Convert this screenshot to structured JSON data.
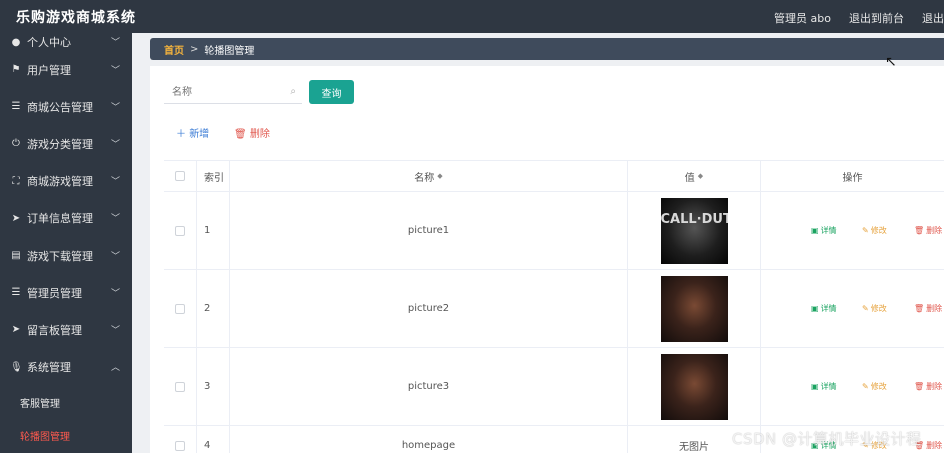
{
  "app": {
    "title": "乐购游戏商城系统"
  },
  "header": {
    "user": "管理员 abo",
    "back_frontend": "退出到前台",
    "logout": "退出"
  },
  "sidebar": {
    "items": [
      {
        "label": "个人中心",
        "icon": "person-icon"
      },
      {
        "label": "用户管理",
        "icon": "flag-icon"
      },
      {
        "label": "商城公告管理",
        "icon": "list-icon"
      },
      {
        "label": "游戏分类管理",
        "icon": "power-icon"
      },
      {
        "label": "商城游戏管理",
        "icon": "frame-icon"
      },
      {
        "label": "订单信息管理",
        "icon": "send-icon"
      },
      {
        "label": "游戏下载管理",
        "icon": "card-icon"
      },
      {
        "label": "管理员管理",
        "icon": "list-icon"
      },
      {
        "label": "留言板管理",
        "icon": "send-icon"
      },
      {
        "label": "系统管理",
        "icon": "mic-icon"
      }
    ],
    "sub_items": [
      {
        "label": "客服管理",
        "active": false
      },
      {
        "label": "轮播图管理",
        "active": true
      }
    ],
    "active_color": "#ff5a4e"
  },
  "breadcrumb": {
    "home": "首页",
    "sep": ">",
    "current": "轮播图管理"
  },
  "search": {
    "placeholder": "名称",
    "button": "查询"
  },
  "actions": {
    "add": "新增",
    "delete": "删除"
  },
  "table": {
    "headers": {
      "index": "索引",
      "name": "名称",
      "value": "值",
      "ops": "操作"
    },
    "ops": {
      "detail": "详情",
      "edit": "修改",
      "remove": "删除"
    },
    "rows": [
      {
        "index": "1",
        "name": "picture1",
        "image": "cod"
      },
      {
        "index": "2",
        "name": "picture2",
        "image": "dark"
      },
      {
        "index": "3",
        "name": "picture3",
        "image": "dark"
      },
      {
        "index": "4",
        "name": "homepage",
        "value_text": "无图片"
      }
    ],
    "cod_image_text": "CALL·DUTY"
  },
  "watermark": "CSDN @计算机毕业设计程",
  "colors": {
    "primary": "#1aa392",
    "sidebar_bg": "#2f3742",
    "breadcrumb_bg": "#3f4b5c",
    "danger": "#e0564c",
    "warning": "#e6a23c",
    "success": "#1aa360"
  }
}
